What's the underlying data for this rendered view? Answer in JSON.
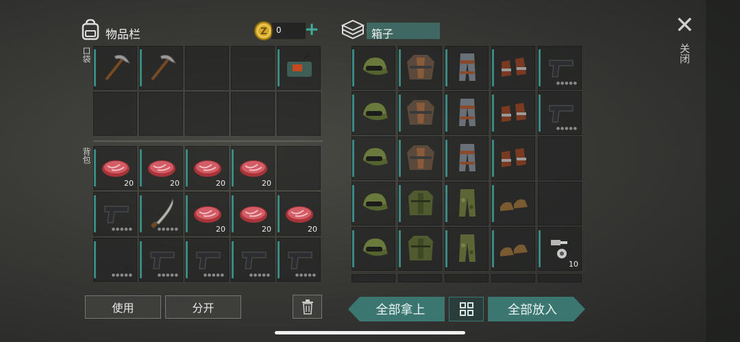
{
  "inventory": {
    "title": "物品栏",
    "coins": "0",
    "add_icon": "plus-icon",
    "pocket_label": "口袋",
    "backpack_label": "背包",
    "pocket": [
      {
        "icon": "pickaxe-icon"
      },
      {
        "icon": "pickaxe-icon"
      },
      {
        "icon": ""
      },
      {
        "icon": ""
      },
      {
        "icon": "dynamite-icon"
      },
      {
        "icon": ""
      },
      {
        "icon": ""
      },
      {
        "icon": ""
      },
      {
        "icon": ""
      },
      {
        "icon": ""
      }
    ],
    "backpack": [
      {
        "icon": "meat-icon",
        "qty": "20"
      },
      {
        "icon": "meat-icon",
        "qty": "20"
      },
      {
        "icon": "meat-icon",
        "qty": "20"
      },
      {
        "icon": "meat-icon",
        "qty": "20"
      },
      {
        "icon": ""
      },
      {
        "icon": "pistol-icon",
        "qty": ""
      },
      {
        "icon": "machete-icon",
        "qty": ""
      },
      {
        "icon": "meat-icon",
        "qty": "20"
      },
      {
        "icon": "meat-icon",
        "qty": "20"
      },
      {
        "icon": "meat-icon",
        "qty": "20"
      },
      {
        "icon": "rifle-icon",
        "qty": ""
      },
      {
        "icon": "pistol-icon",
        "qty": ""
      },
      {
        "icon": "pistol-icon",
        "qty": ""
      },
      {
        "icon": "pistol-icon",
        "qty": ""
      },
      {
        "icon": "pistol-icon",
        "qty": ""
      }
    ],
    "use_button": "使用",
    "split_button": "分开"
  },
  "box": {
    "title": "箱子",
    "grid": [
      {
        "icon": "cap-icon"
      },
      {
        "icon": "jacket-icon"
      },
      {
        "icon": "pants-icon"
      },
      {
        "icon": "boots-icon"
      },
      {
        "icon": "pistol-icon"
      },
      {
        "icon": "cap-icon"
      },
      {
        "icon": "jacket-icon"
      },
      {
        "icon": "pants-icon"
      },
      {
        "icon": "boots-icon"
      },
      {
        "icon": "pistol-icon"
      },
      {
        "icon": "cap-icon"
      },
      {
        "icon": "jacket-icon"
      },
      {
        "icon": "pants-icon"
      },
      {
        "icon": "boots-icon"
      },
      {
        "icon": ""
      },
      {
        "icon": "cap-icon"
      },
      {
        "icon": "vest-icon"
      },
      {
        "icon": "camo-pants-icon"
      },
      {
        "icon": "shoes-icon"
      },
      {
        "icon": ""
      },
      {
        "icon": "cap-icon"
      },
      {
        "icon": "vest-icon"
      },
      {
        "icon": "camo-pants-icon"
      },
      {
        "icon": "shoes-icon"
      },
      {
        "icon": "bolts-icon",
        "qty": "10"
      }
    ],
    "take_all": "全部拿上",
    "put_all": "全部放入"
  },
  "close_label": "关闭",
  "colors": {
    "accent": "#3b7671",
    "coin": "#d6a92a"
  }
}
